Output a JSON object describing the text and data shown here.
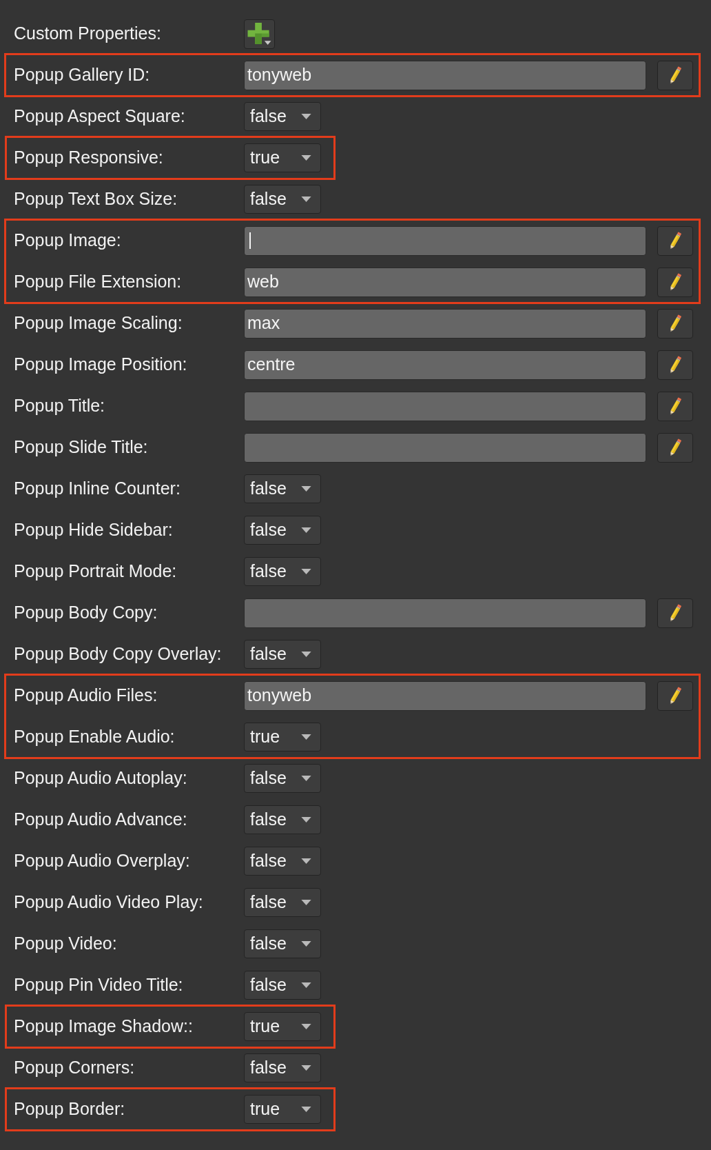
{
  "custom_properties": {
    "label": "Custom Properties:"
  },
  "groups": [
    {
      "highlighted": true,
      "rows": [
        {
          "kind": "text",
          "label": "Popup Gallery ID:",
          "value": "tonyweb",
          "focused": false
        }
      ]
    },
    {
      "highlighted": false,
      "rows": [
        {
          "kind": "dropdown",
          "label": "Popup Aspect Square:",
          "value": "false"
        }
      ]
    },
    {
      "highlighted": true,
      "rows": [
        {
          "kind": "dropdown",
          "label": "Popup Responsive:",
          "value": "true"
        }
      ]
    },
    {
      "highlighted": false,
      "rows": [
        {
          "kind": "dropdown",
          "label": "Popup Text Box Size:",
          "value": "false"
        }
      ]
    },
    {
      "highlighted": true,
      "rows": [
        {
          "kind": "text",
          "label": "Popup Image:",
          "focused": true
        },
        {
          "kind": "text",
          "label": "Popup File Extension:",
          "value": "web",
          "focused": false
        }
      ]
    },
    {
      "highlighted": false,
      "rows": [
        {
          "kind": "text",
          "label": "Popup Image Scaling:",
          "value": "max",
          "focused": false
        },
        {
          "kind": "text",
          "label": "Popup Image Position:",
          "value": "centre",
          "focused": false
        },
        {
          "kind": "text",
          "label": "Popup Title:",
          "focused": false
        },
        {
          "kind": "text",
          "label": "Popup Slide Title:",
          "focused": false
        },
        {
          "kind": "dropdown",
          "label": "Popup Inline Counter:",
          "value": "false"
        },
        {
          "kind": "dropdown",
          "label": "Popup Hide Sidebar:",
          "value": "false"
        },
        {
          "kind": "dropdown",
          "label": "Popup Portrait Mode:",
          "value": "false"
        },
        {
          "kind": "text",
          "label": "Popup Body Copy:",
          "focused": false
        },
        {
          "kind": "dropdown",
          "label": "Popup Body Copy Overlay:",
          "value": "false"
        }
      ]
    },
    {
      "highlighted": true,
      "rows": [
        {
          "kind": "text",
          "label": "Popup Audio Files:",
          "value": "tonyweb",
          "focused": false
        },
        {
          "kind": "dropdown",
          "label": "Popup Enable Audio:",
          "value": "true"
        }
      ]
    },
    {
      "highlighted": false,
      "rows": [
        {
          "kind": "dropdown",
          "label": "Popup Audio Autoplay:",
          "value": "false"
        },
        {
          "kind": "dropdown",
          "label": "Popup Audio Advance:",
          "value": "false"
        },
        {
          "kind": "dropdown",
          "label": "Popup Audio Overplay:",
          "value": "false"
        },
        {
          "kind": "dropdown",
          "label": "Popup Audio Video Play:",
          "value": "false"
        },
        {
          "kind": "dropdown",
          "label": "Popup Video:",
          "value": "false"
        },
        {
          "kind": "dropdown",
          "label": "Popup Pin Video Title:",
          "value": "false"
        }
      ]
    },
    {
      "highlighted": true,
      "rows": [
        {
          "kind": "dropdown",
          "label": "Popup Image Shadow::",
          "value": "true"
        }
      ]
    },
    {
      "highlighted": false,
      "rows": [
        {
          "kind": "dropdown",
          "label": "Popup Corners:",
          "value": "false"
        }
      ]
    },
    {
      "highlighted": true,
      "rows": [
        {
          "kind": "dropdown",
          "label": "Popup Border:",
          "value": "true"
        }
      ]
    }
  ]
}
